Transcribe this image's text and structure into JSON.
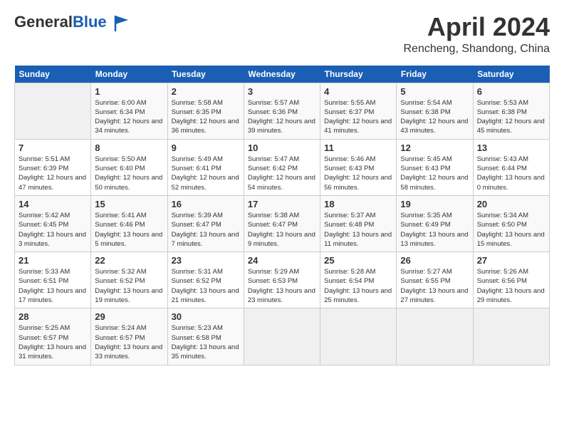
{
  "header": {
    "logo_general": "General",
    "logo_blue": "Blue",
    "month_title": "April 2024",
    "location": "Rencheng, Shandong, China"
  },
  "days_of_week": [
    "Sunday",
    "Monday",
    "Tuesday",
    "Wednesday",
    "Thursday",
    "Friday",
    "Saturday"
  ],
  "weeks": [
    [
      {
        "day": "",
        "sunrise": "",
        "sunset": "",
        "daylight": ""
      },
      {
        "day": "1",
        "sunrise": "Sunrise: 6:00 AM",
        "sunset": "Sunset: 6:34 PM",
        "daylight": "Daylight: 12 hours and 34 minutes."
      },
      {
        "day": "2",
        "sunrise": "Sunrise: 5:58 AM",
        "sunset": "Sunset: 6:35 PM",
        "daylight": "Daylight: 12 hours and 36 minutes."
      },
      {
        "day": "3",
        "sunrise": "Sunrise: 5:57 AM",
        "sunset": "Sunset: 6:36 PM",
        "daylight": "Daylight: 12 hours and 39 minutes."
      },
      {
        "day": "4",
        "sunrise": "Sunrise: 5:55 AM",
        "sunset": "Sunset: 6:37 PM",
        "daylight": "Daylight: 12 hours and 41 minutes."
      },
      {
        "day": "5",
        "sunrise": "Sunrise: 5:54 AM",
        "sunset": "Sunset: 6:38 PM",
        "daylight": "Daylight: 12 hours and 43 minutes."
      },
      {
        "day": "6",
        "sunrise": "Sunrise: 5:53 AM",
        "sunset": "Sunset: 6:38 PM",
        "daylight": "Daylight: 12 hours and 45 minutes."
      }
    ],
    [
      {
        "day": "7",
        "sunrise": "Sunrise: 5:51 AM",
        "sunset": "Sunset: 6:39 PM",
        "daylight": "Daylight: 12 hours and 47 minutes."
      },
      {
        "day": "8",
        "sunrise": "Sunrise: 5:50 AM",
        "sunset": "Sunset: 6:40 PM",
        "daylight": "Daylight: 12 hours and 50 minutes."
      },
      {
        "day": "9",
        "sunrise": "Sunrise: 5:49 AM",
        "sunset": "Sunset: 6:41 PM",
        "daylight": "Daylight: 12 hours and 52 minutes."
      },
      {
        "day": "10",
        "sunrise": "Sunrise: 5:47 AM",
        "sunset": "Sunset: 6:42 PM",
        "daylight": "Daylight: 12 hours and 54 minutes."
      },
      {
        "day": "11",
        "sunrise": "Sunrise: 5:46 AM",
        "sunset": "Sunset: 6:43 PM",
        "daylight": "Daylight: 12 hours and 56 minutes."
      },
      {
        "day": "12",
        "sunrise": "Sunrise: 5:45 AM",
        "sunset": "Sunset: 6:43 PM",
        "daylight": "Daylight: 12 hours and 58 minutes."
      },
      {
        "day": "13",
        "sunrise": "Sunrise: 5:43 AM",
        "sunset": "Sunset: 6:44 PM",
        "daylight": "Daylight: 13 hours and 0 minutes."
      }
    ],
    [
      {
        "day": "14",
        "sunrise": "Sunrise: 5:42 AM",
        "sunset": "Sunset: 6:45 PM",
        "daylight": "Daylight: 13 hours and 3 minutes."
      },
      {
        "day": "15",
        "sunrise": "Sunrise: 5:41 AM",
        "sunset": "Sunset: 6:46 PM",
        "daylight": "Daylight: 13 hours and 5 minutes."
      },
      {
        "day": "16",
        "sunrise": "Sunrise: 5:39 AM",
        "sunset": "Sunset: 6:47 PM",
        "daylight": "Daylight: 13 hours and 7 minutes."
      },
      {
        "day": "17",
        "sunrise": "Sunrise: 5:38 AM",
        "sunset": "Sunset: 6:47 PM",
        "daylight": "Daylight: 13 hours and 9 minutes."
      },
      {
        "day": "18",
        "sunrise": "Sunrise: 5:37 AM",
        "sunset": "Sunset: 6:48 PM",
        "daylight": "Daylight: 13 hours and 11 minutes."
      },
      {
        "day": "19",
        "sunrise": "Sunrise: 5:35 AM",
        "sunset": "Sunset: 6:49 PM",
        "daylight": "Daylight: 13 hours and 13 minutes."
      },
      {
        "day": "20",
        "sunrise": "Sunrise: 5:34 AM",
        "sunset": "Sunset: 6:50 PM",
        "daylight": "Daylight: 13 hours and 15 minutes."
      }
    ],
    [
      {
        "day": "21",
        "sunrise": "Sunrise: 5:33 AM",
        "sunset": "Sunset: 6:51 PM",
        "daylight": "Daylight: 13 hours and 17 minutes."
      },
      {
        "day": "22",
        "sunrise": "Sunrise: 5:32 AM",
        "sunset": "Sunset: 6:52 PM",
        "daylight": "Daylight: 13 hours and 19 minutes."
      },
      {
        "day": "23",
        "sunrise": "Sunrise: 5:31 AM",
        "sunset": "Sunset: 6:52 PM",
        "daylight": "Daylight: 13 hours and 21 minutes."
      },
      {
        "day": "24",
        "sunrise": "Sunrise: 5:29 AM",
        "sunset": "Sunset: 6:53 PM",
        "daylight": "Daylight: 13 hours and 23 minutes."
      },
      {
        "day": "25",
        "sunrise": "Sunrise: 5:28 AM",
        "sunset": "Sunset: 6:54 PM",
        "daylight": "Daylight: 13 hours and 25 minutes."
      },
      {
        "day": "26",
        "sunrise": "Sunrise: 5:27 AM",
        "sunset": "Sunset: 6:55 PM",
        "daylight": "Daylight: 13 hours and 27 minutes."
      },
      {
        "day": "27",
        "sunrise": "Sunrise: 5:26 AM",
        "sunset": "Sunset: 6:56 PM",
        "daylight": "Daylight: 13 hours and 29 minutes."
      }
    ],
    [
      {
        "day": "28",
        "sunrise": "Sunrise: 5:25 AM",
        "sunset": "Sunset: 6:57 PM",
        "daylight": "Daylight: 13 hours and 31 minutes."
      },
      {
        "day": "29",
        "sunrise": "Sunrise: 5:24 AM",
        "sunset": "Sunset: 6:57 PM",
        "daylight": "Daylight: 13 hours and 33 minutes."
      },
      {
        "day": "30",
        "sunrise": "Sunrise: 5:23 AM",
        "sunset": "Sunset: 6:58 PM",
        "daylight": "Daylight: 13 hours and 35 minutes."
      },
      {
        "day": "",
        "sunrise": "",
        "sunset": "",
        "daylight": ""
      },
      {
        "day": "",
        "sunrise": "",
        "sunset": "",
        "daylight": ""
      },
      {
        "day": "",
        "sunrise": "",
        "sunset": "",
        "daylight": ""
      },
      {
        "day": "",
        "sunrise": "",
        "sunset": "",
        "daylight": ""
      }
    ]
  ]
}
